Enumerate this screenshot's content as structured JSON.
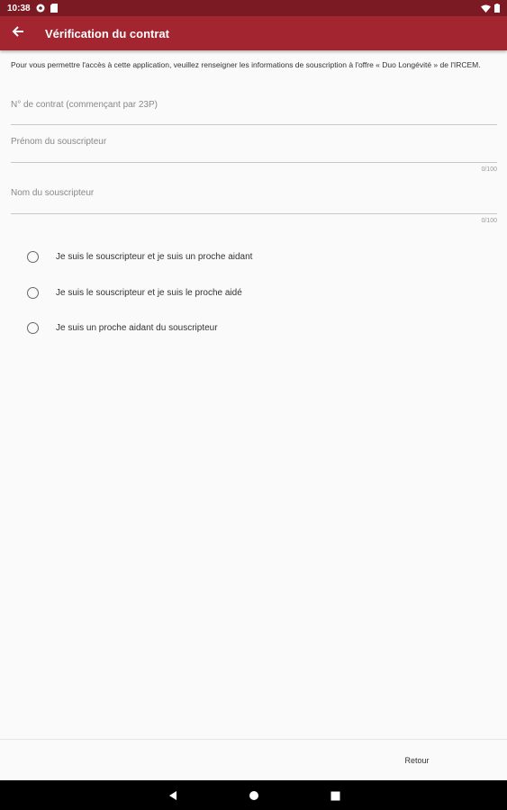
{
  "status_bar": {
    "time": "10:38"
  },
  "app_bar": {
    "title": "Vérification du contrat"
  },
  "intro_text": "Pour vous permettre l'accès à cette application, veuillez renseigner les informations de souscription à l'offre « Duo Longévité » de l'IRCEM.",
  "fields": {
    "contract": {
      "placeholder": "N° de contrat (commençant par 23P)"
    },
    "firstname": {
      "placeholder": "Prénom du souscripteur",
      "counter": "0/100"
    },
    "lastname": {
      "placeholder": "Nom du souscripteur",
      "counter": "0/100"
    }
  },
  "radio_options": [
    {
      "label": "Je suis le souscripteur et je suis un proche aidant"
    },
    {
      "label": "Je suis le souscripteur et je suis le proche aidé"
    },
    {
      "label": "Je suis un proche aidant du souscripteur"
    }
  ],
  "bottom_bar": {
    "retour_label": "Retour"
  },
  "colors": {
    "status_bar": "#7b1a22",
    "app_bar": "#a32530",
    "background": "#fafafa",
    "nav_bar": "#000000"
  },
  "icons": [
    "browser-notification-icon",
    "sim-card-icon",
    "wifi-icon",
    "battery-icon",
    "back-arrow-icon",
    "nav-back-icon",
    "nav-home-icon",
    "nav-recents-icon"
  ]
}
